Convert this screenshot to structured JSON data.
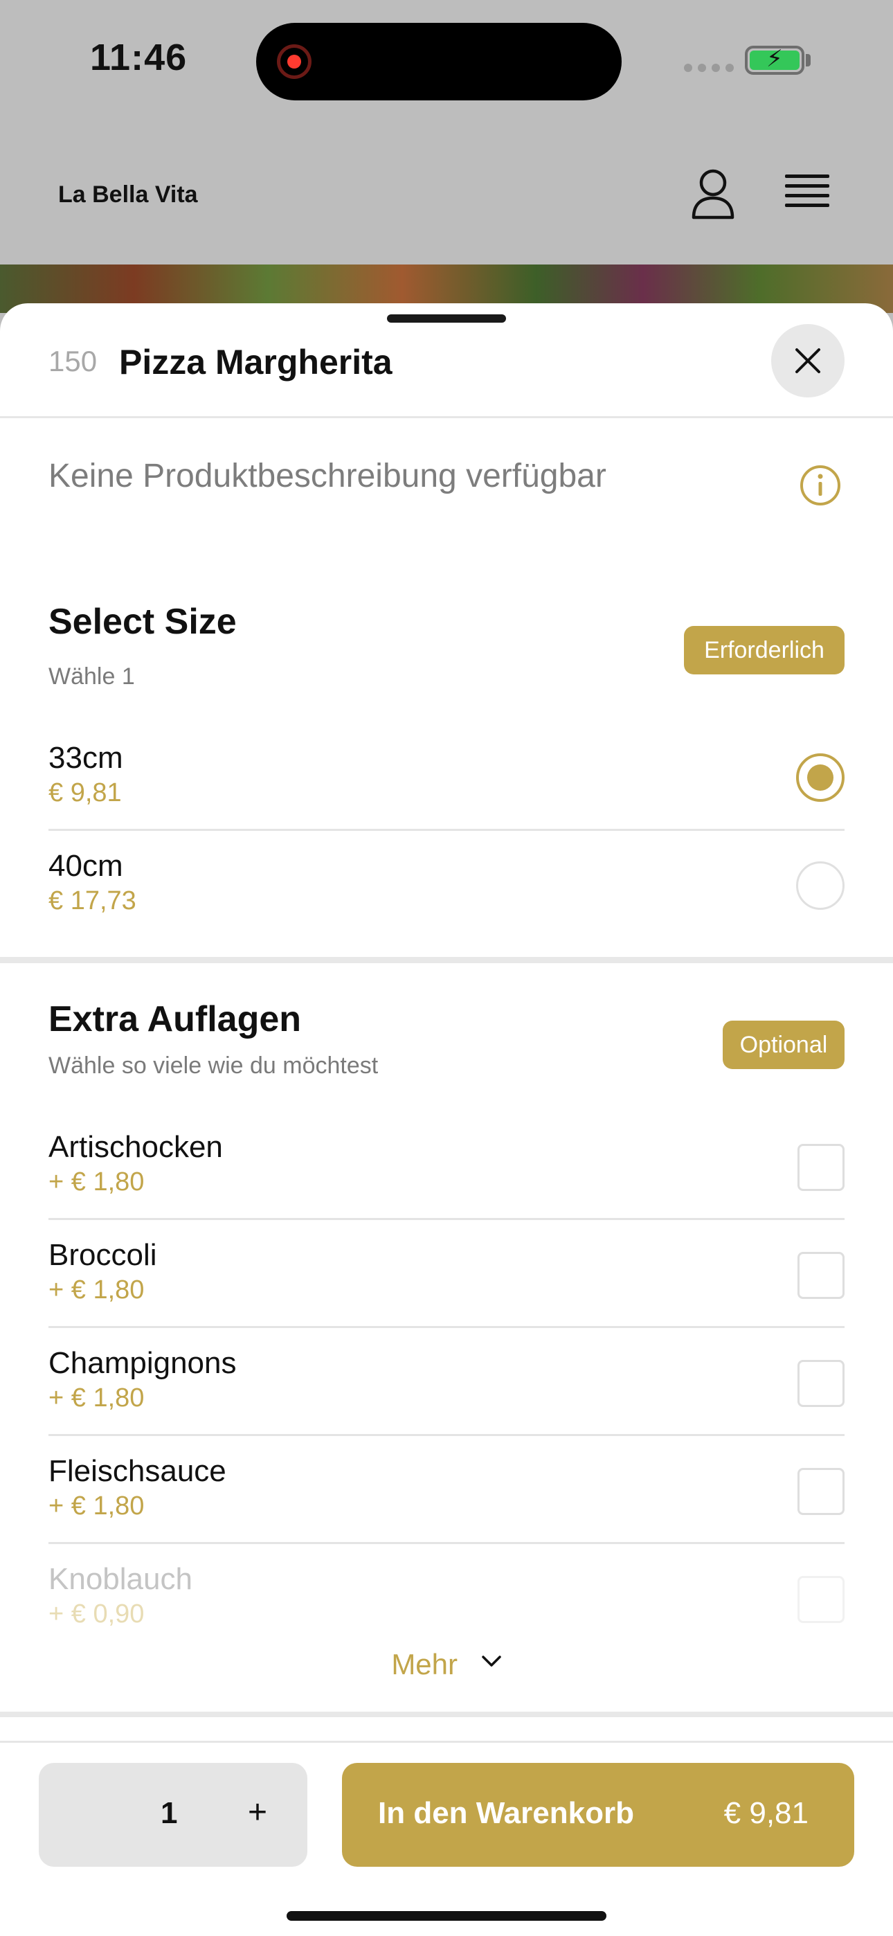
{
  "status_bar": {
    "time": "11:46"
  },
  "header": {
    "brand": "La Bella Vita"
  },
  "item": {
    "number": "150",
    "title": "Pizza Margherita",
    "description": "Keine Produktbeschreibung verfügbar"
  },
  "size_section": {
    "title": "Select Size",
    "subtitle": "Wähle 1",
    "badge": "Erforderlich",
    "options": [
      {
        "name": "33cm",
        "price": "€ 9,81",
        "selected": true
      },
      {
        "name": "40cm",
        "price": "€ 17,73",
        "selected": false
      }
    ]
  },
  "extras_section": {
    "title": "Extra Auflagen",
    "subtitle": "Wähle so viele wie du möchtest",
    "badge": "Optional",
    "options": [
      {
        "name": "Artischocken",
        "price": "+ € 1,80"
      },
      {
        "name": "Broccoli",
        "price": "+ € 1,80"
      },
      {
        "name": "Champignons",
        "price": "+ € 1,80"
      },
      {
        "name": "Fleischsauce",
        "price": "+ € 1,80"
      },
      {
        "name": "Knoblauch",
        "price": "+ € 0,90"
      }
    ],
    "more_label": "Mehr"
  },
  "footer": {
    "quantity": "1",
    "plus_label": "+",
    "cart_label": "In den Warenkorb",
    "cart_price": "€ 9,81"
  },
  "colors": {
    "accent": "#c2a54a"
  },
  "icons": [
    "record-icon",
    "battery-icon",
    "user-icon",
    "menu-icon",
    "close-icon",
    "info-icon",
    "chevron-down-icon"
  ]
}
